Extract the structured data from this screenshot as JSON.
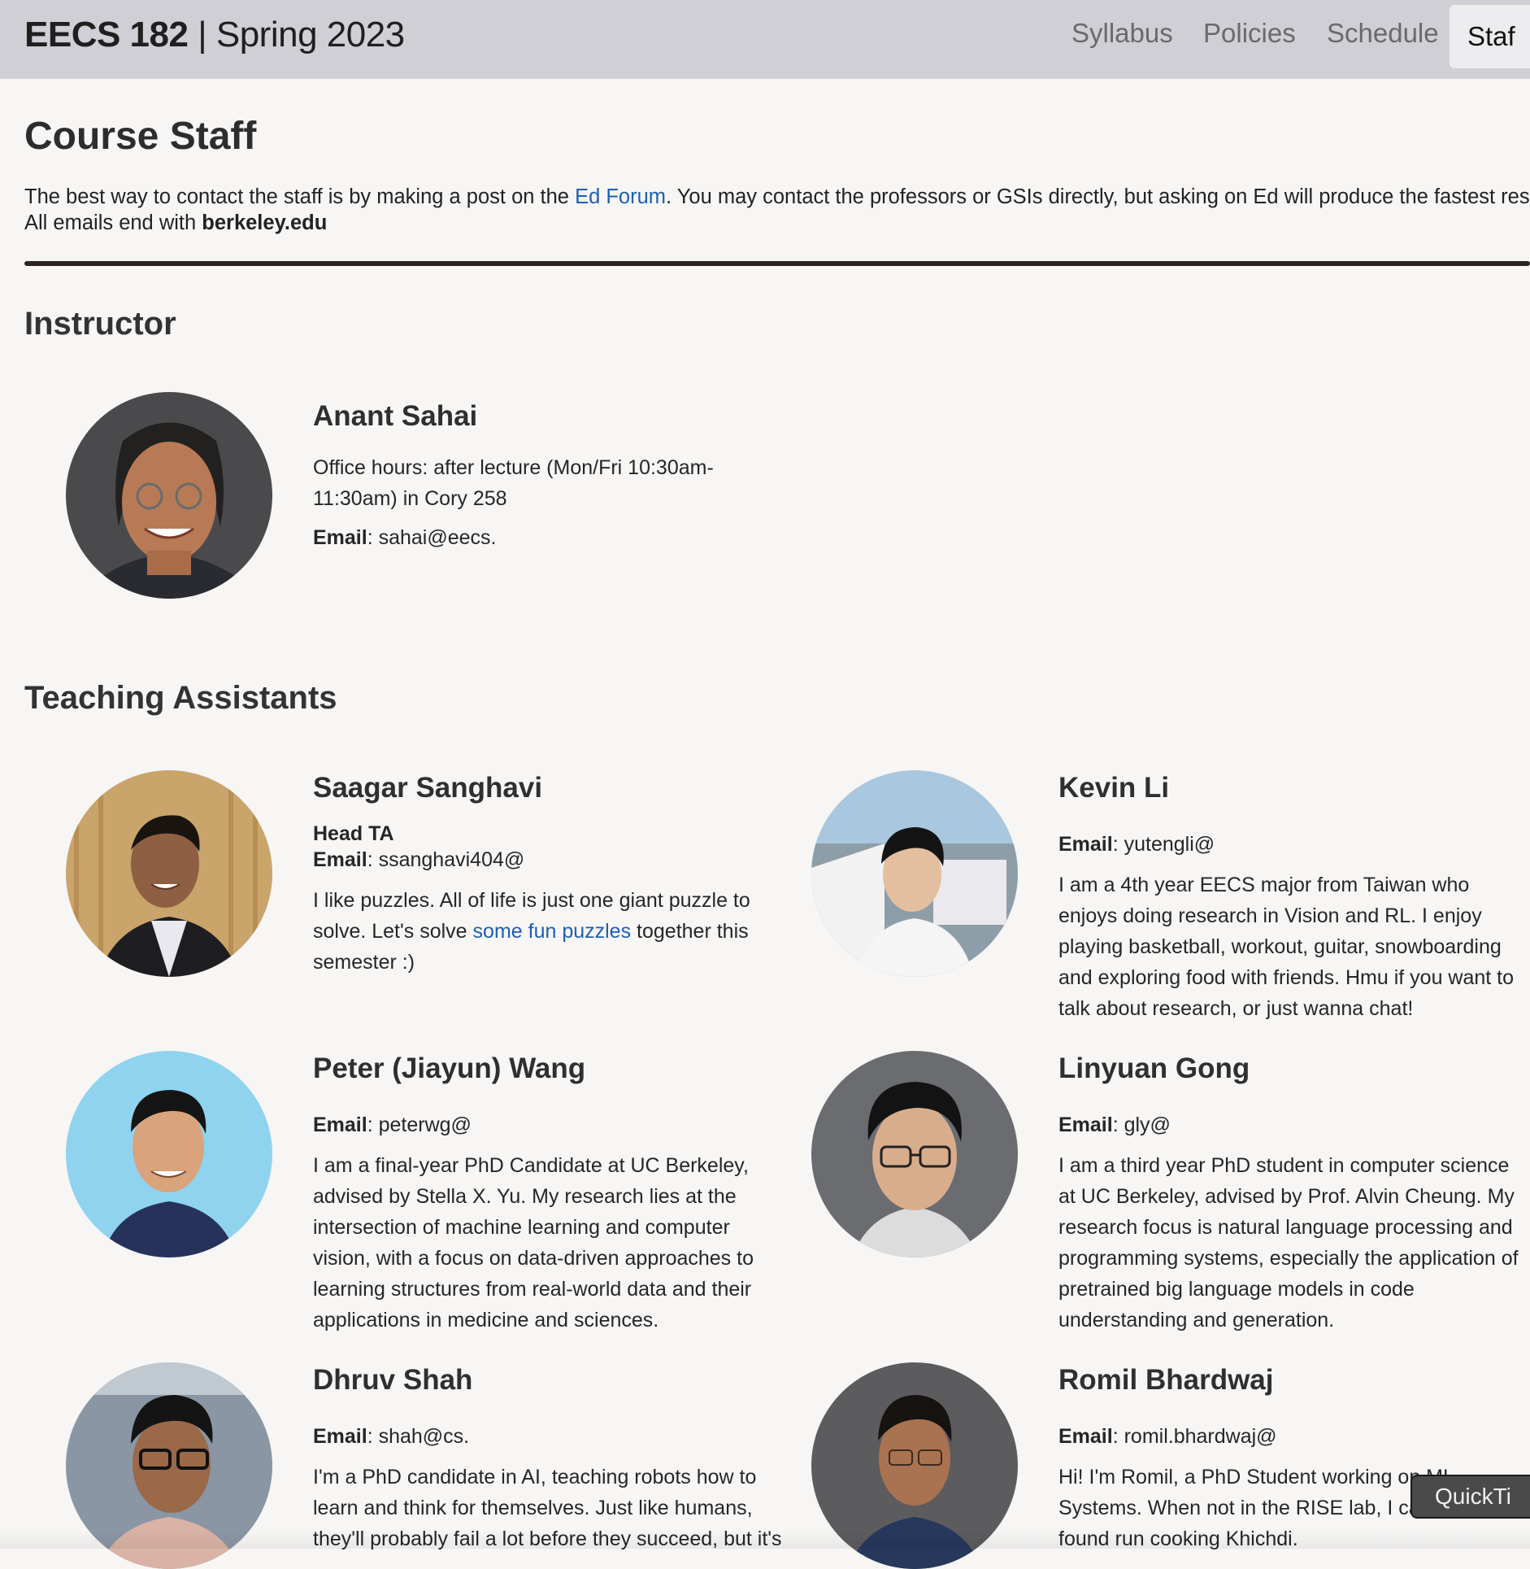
{
  "header": {
    "course_code": "EECS 182",
    "separator": " | ",
    "term": "Spring 2023",
    "nav": [
      "Syllabus",
      "Policies",
      "Schedule",
      "Staf"
    ]
  },
  "page": {
    "title": "Course Staff",
    "intro_1": "The best way to contact the staff is by making a post on the ",
    "intro_link": "Ed Forum",
    "intro_2": ". You may contact the professors or GSIs directly, but asking on Ed will produce the fastest respon",
    "intro_3": "All emails end with ",
    "intro_domain": "berkeley.edu"
  },
  "instructor_section": {
    "title": "Instructor",
    "name": "Anant Sahai",
    "office_hours": "Office hours: after lecture (Mon/Fri 10:30am-11:30am) in Cory 258",
    "email_label": "Email",
    "email": ": sahai@eecs."
  },
  "ta_section": {
    "title": "Teaching Assistants",
    "email_label": "Email",
    "tas": [
      {
        "name": "Saagar Sanghavi",
        "role": "Head TA",
        "email": ": ssanghavi404@",
        "bio_1": "I like puzzles. All of life is just one giant puzzle to solve. Let's solve ",
        "bio_link": "some fun puzzles",
        "bio_2": " together this semester :)"
      },
      {
        "name": "Kevin Li",
        "email": ": yutengli@",
        "bio": "I am a 4th year EECS major from Taiwan who enjoys doing research in Vision and RL. I enjoy playing basketball, workout, guitar, snowboarding and exploring food with friends. Hmu if you want to talk about research, or just wanna chat!"
      },
      {
        "name": "Peter (Jiayun) Wang",
        "email": ": peterwg@",
        "bio": "I am a final-year PhD Candidate at UC Berkeley, advised by Stella X. Yu. My research lies at the intersection of machine learning and computer vision, with a focus on data-driven approaches to learning structures from real-world data and their applications in medicine and sciences."
      },
      {
        "name": "Linyuan Gong",
        "email": ": gly@",
        "bio": "I am a third year PhD student in computer science at UC Berkeley, advised by Prof. Alvin Cheung. My research focus is natural language processing and programming systems, especially the application of pretrained big language models in code understanding and generation."
      },
      {
        "name": "Dhruv Shah",
        "email": ": shah@cs.",
        "bio": "I'm a PhD candidate in AI, teaching robots how to learn and think for themselves. Just like humans, they'll probably fail a lot before they succeed, but it's"
      },
      {
        "name": "Romil Bhardwaj",
        "email": ": romil.bhardwaj@",
        "bio": "Hi! I'm Romil, a PhD Student working on ML Systems. When not in the RISE lab, I can be found run cooking Khichdi."
      }
    ]
  },
  "widget": {
    "quicktip": "QuickTi"
  },
  "colors": {
    "header_bg": "#d0cfd6",
    "page_bg": "#f7f6f5",
    "link": "#1d5fb3",
    "rule": "#2c2424"
  },
  "icons": [
    "person-photo-icon"
  ]
}
